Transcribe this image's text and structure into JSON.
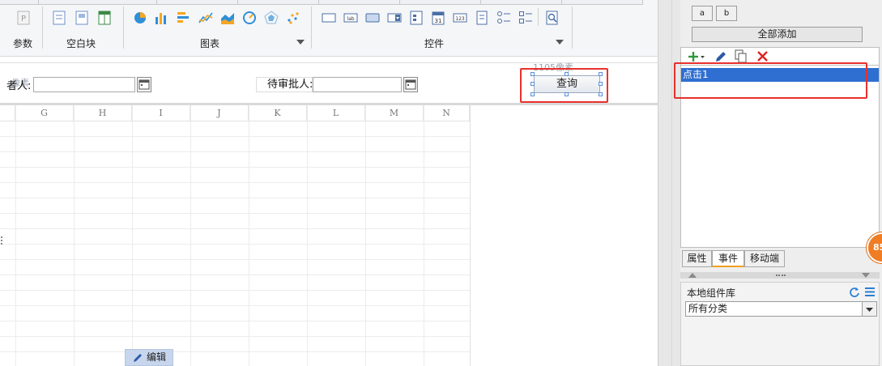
{
  "ribbon": {
    "groups": [
      {
        "label": "参数"
      },
      {
        "label": "空白块"
      },
      {
        "label": "图表"
      },
      {
        "label": "控件"
      }
    ]
  },
  "form": {
    "field1_label": "者人:",
    "field2_label": "待审批人:",
    "query_button_label": "查询",
    "hint_left": "像素",
    "hint_right": "1105像素"
  },
  "grid": {
    "columns": [
      "G",
      "H",
      "I",
      "J",
      "K",
      "L",
      "M",
      "N"
    ]
  },
  "edit_button_label": "编辑",
  "right_panel": {
    "btn_a": "a",
    "btn_b": "b",
    "add_all_label": "全部添加",
    "events": [
      "点击1"
    ],
    "tabs": [
      "属性",
      "事件",
      "移动端"
    ],
    "library_title": "本地组件库",
    "library_select_value": "所有分类",
    "badge_text": "85"
  },
  "colors": {
    "selection_blue": "#2f6fd1",
    "highlight_red": "#e8312c",
    "badge_orange": "#f07c23"
  }
}
